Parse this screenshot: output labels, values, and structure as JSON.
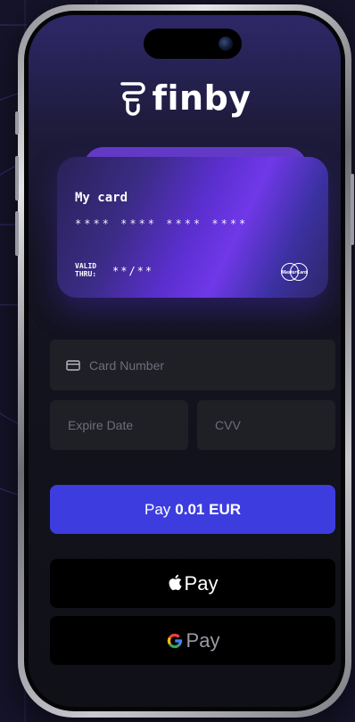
{
  "brand": {
    "name": "finby"
  },
  "card": {
    "title": "My card",
    "number_mask": "**** **** **** ****",
    "valid_label_line1": "VALID",
    "valid_label_line2": "THRU:",
    "valid_value": "**/**",
    "network_logo": "MasterCard",
    "network_icon": "mastercard-icon"
  },
  "form": {
    "card_number_placeholder": "Card Number",
    "card_number_icon": "credit-card-icon",
    "expire_placeholder": "Expire Date",
    "cvv_placeholder": "CVV"
  },
  "pay_button": {
    "prefix": "Pay",
    "amount": "0.01 EUR"
  },
  "apple_pay": {
    "label": "Pay",
    "icon": "apple-icon"
  },
  "google_pay": {
    "label": "Pay",
    "icon": "google-g-icon"
  },
  "colors": {
    "accent": "#3d3ddf",
    "card_purple": "#7038e8",
    "field_bg": "#1f1f26",
    "wallet_bg": "#000000"
  }
}
